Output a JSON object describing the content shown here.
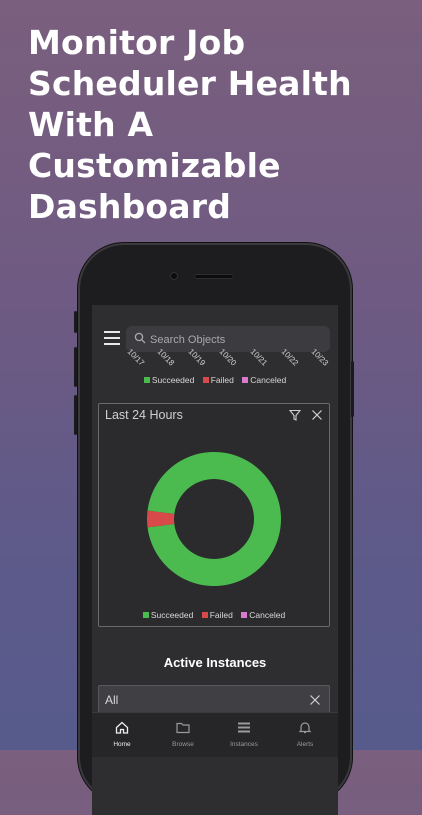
{
  "headline": [
    "Monitor Job",
    "Scheduler Health",
    "With A Customizable",
    "Dashboard"
  ],
  "search": {
    "placeholder": "Search Objects"
  },
  "date_axis_labels": [
    "10/17",
    "10/18",
    "10/19",
    "10/20",
    "10/21",
    "10/22",
    "10/23"
  ],
  "legend": [
    {
      "label": "Succeeded",
      "color": "#4cbb4f"
    },
    {
      "label": "Failed",
      "color": "#d84a4a"
    },
    {
      "label": "Canceled",
      "color": "#d77ad0"
    }
  ],
  "card": {
    "title": "Last 24 Hours"
  },
  "chart_data": {
    "type": "pie",
    "title": "Last 24 Hours",
    "categories": [
      "Succeeded",
      "Failed",
      "Canceled"
    ],
    "values": [
      96,
      4,
      0
    ],
    "colors": [
      "#4cbb4f",
      "#d84a4a",
      "#d77ad0"
    ]
  },
  "active_instances": {
    "title": "Active Instances",
    "filter_value": "All"
  },
  "tabs": [
    {
      "label": "Home",
      "icon": "home-icon"
    },
    {
      "label": "Browse",
      "icon": "folder-icon"
    },
    {
      "label": "Instances",
      "icon": "list-icon"
    },
    {
      "label": "Alerts",
      "icon": "bell-icon"
    }
  ]
}
